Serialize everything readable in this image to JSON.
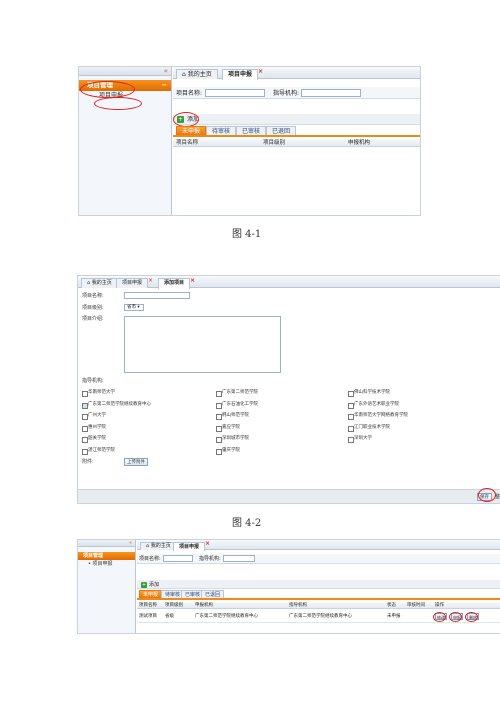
{
  "fig1": {
    "collapse_glyph": "«",
    "sidebar_group": "项目管理",
    "sidebar_collapse": "−",
    "sidebar_item": "项目申报",
    "tabs": [
      "我的主页",
      "项目申报"
    ],
    "tab_close": "×",
    "search_labels": [
      "项目名称:",
      "指导机构:"
    ],
    "add_label": "添加",
    "sub_tabs": [
      "未申报",
      "待审核",
      "已审核",
      "已退回"
    ],
    "columns": [
      "项目名称",
      "项目级别",
      "申报机构"
    ],
    "caption": "图 4-1"
  },
  "fig2": {
    "tabs": [
      "我的主页",
      "项目申报",
      "添加项目"
    ],
    "tab_close": "×",
    "form_labels": [
      "项目名称:",
      "项目级别:",
      "项目介绍:"
    ],
    "level_value": "省市",
    "institution_label": "指导机构:",
    "institutions": [
      [
        "华南师范大学",
        "广东第二师范学院",
        "佛山科学技术学院"
      ],
      [
        "广东第二师范学院继续教育中心",
        "广东石油化工学院",
        "广东外语艺术职业学院"
      ],
      [
        "广州大学",
        "韩山师范学院",
        "华南师范大学网络教育学院"
      ],
      [
        "惠州学院",
        "嘉应学院",
        "江门职业技术学院"
      ],
      [
        "韶关学院",
        "深圳城市学院",
        "深圳大学"
      ],
      [
        "湛江师范学院",
        "肇庆学院",
        ""
      ]
    ],
    "checked": "广东第二师范学院继续教育中心",
    "attachment_label": "附件:",
    "upload_label": "上传附件",
    "save_label": "保存",
    "cut_label": "整",
    "caption": "图 4-2"
  },
  "fig3": {
    "sidebar_group": "项目管理",
    "sidebar_item": "项目申报",
    "tabs": [
      "我的主页",
      "项目申报"
    ],
    "tab_close": "×",
    "search_labels": [
      "项目名称:",
      "指导机构:"
    ],
    "add_label": "添加",
    "sub_tabs": [
      "未申报",
      "待审核",
      "已审核",
      "已退回"
    ],
    "columns": [
      "项目名称",
      "项目级别",
      "申报机构",
      "指导机构",
      "状态",
      "审核时间",
      "操作"
    ],
    "row": {
      "name": "测试项目",
      "level": "省级",
      "applicant": "广东第二师范学院继续教育中心",
      "guide": "广东第二师范学院继续教育中心",
      "status": "未申报",
      "time": ""
    },
    "actions": [
      "修改",
      "申报",
      "删除"
    ]
  }
}
